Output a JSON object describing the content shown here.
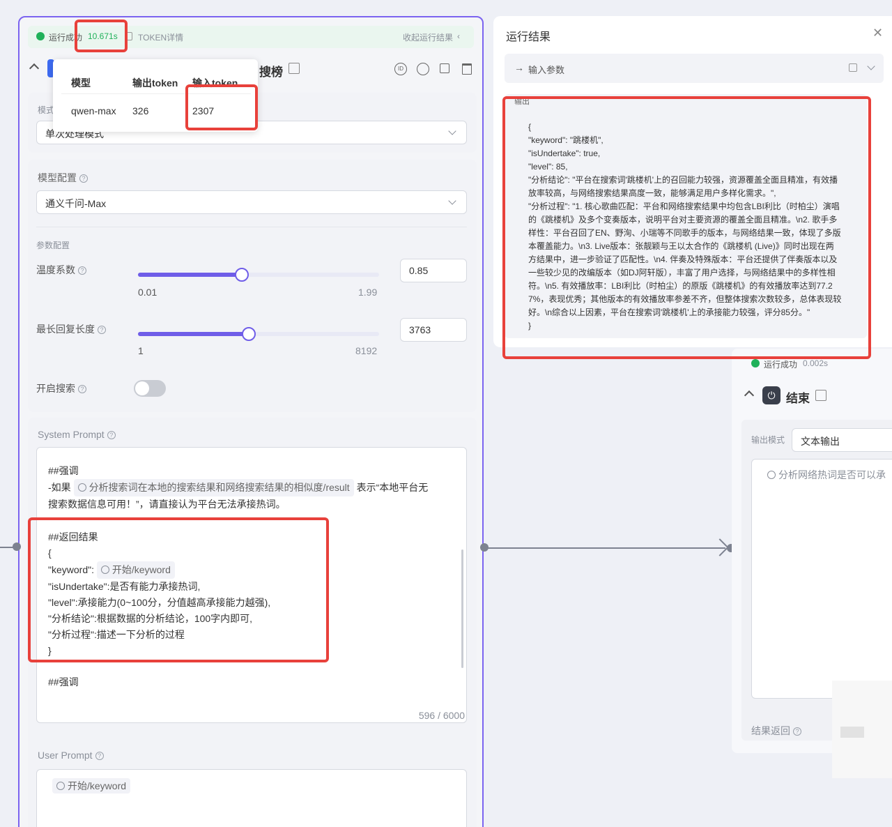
{
  "left": {
    "status": {
      "text": "运行成功",
      "time": "10.671s",
      "token_link": "TOKEN详情",
      "collapse": "收起运行结果"
    },
    "node_title": "搜榜",
    "token_table": {
      "headers": [
        "模型",
        "输出token",
        "输入token"
      ],
      "row": [
        "qwen-max",
        "326",
        "2307"
      ]
    },
    "mode": {
      "label": "模式",
      "value": "单次处理模式"
    },
    "model_config": {
      "label": "模型配置",
      "value": "通义千问-Max"
    },
    "params": {
      "label": "参数配置",
      "temperature": {
        "label": "温度系数",
        "min": "0.01",
        "max": "1.99",
        "value": "0.85",
        "fraction": 0.43
      },
      "max_length": {
        "label": "最长回复长度",
        "min": "1",
        "max": "8192",
        "value": "3763",
        "fraction": 0.46
      },
      "search": {
        "label": "开启搜索",
        "enabled": false
      }
    },
    "system_prompt": {
      "label": "System Prompt",
      "l1": "##强调",
      "l2a": "-如果",
      "l2_tag": "分析搜索词在本地的搜索结果和网络搜索结果的相似度/result",
      "l2b": "表示“本地平台无",
      "l3": "搜索数据信息可用！”，请直接认为平台无法承接热词。",
      "l4": "##返回结果",
      "l5": "{",
      "l6a": "\"keyword\":",
      "l6_tag": "开始/keyword",
      "l7": "\"isUndertake\":是否有能力承接热词,",
      "l8": "\"level\":承接能力(0~100分，分值越高承接能力越强),",
      "l9": "\"分析结论\":根据数据的分析结论，100字内即可,",
      "l10": "\"分析过程\":描述一下分析的过程",
      "l11": "}",
      "l12": "##强调",
      "counter": "596 / 6000"
    },
    "user_prompt": {
      "label": "User Prompt",
      "tag": "开始/keyword"
    }
  },
  "right": {
    "title": "运行结果",
    "input_params": "输入参数",
    "output_label": "输出",
    "json_lines": [
      "{",
      "\"keyword\": \"跳楼机\",",
      "\"isUndertake\": true,",
      "\"level\": 85,",
      "\"分析结论\": \"平台在搜索词'跳楼机'上的召回能力较强，资源覆盖全面且精准，有效播",
      "放率较高，与网络搜索结果高度一致，能够满足用户多样化需求。\",",
      "\"分析过程\": \"1. 核心歌曲匹配：平台和网络搜索结果中均包含LBI利比（时柏尘）演唱",
      "的《跳楼机》及多个变奏版本，说明平台对主要资源的覆盖全面且精准。\\n2. 歌手多",
      "样性：平台召回了EN、野洵、小瑞等不同歌手的版本，与网络结果一致，体现了多版",
      "本覆盖能力。\\n3. Live版本：张靓颖与王以太合作的《跳楼机 (Live)》同时出现在两",
      "方结果中，进一步验证了匹配性。\\n4. 伴奏及特殊版本：平台还提供了伴奏版本以及",
      "一些较少见的改编版本（如DJ阿轩版），丰富了用户选择，与网络结果中的多样性相",
      "符。\\n5. 有效播放率：LBI利比（时柏尘）的原版《跳楼机》的有效播放率达到77.2",
      "7%，表现优秀；其他版本的有效播放率参差不齐，但整体搜索次数较多，总体表现较",
      "好。\\n综合以上因素，平台在搜索词'跳楼机'上的承接能力较强，评分85分。\"",
      "}"
    ]
  },
  "end_node": {
    "status": "运行成功",
    "time": "0.002s",
    "title": "结束",
    "output_mode_label": "输出模式",
    "output_mode_value": "文本输出",
    "var_tag": "分析网络热词是否可以承",
    "return_label": "结果返回"
  },
  "colors": {
    "accent": "#6f5de8",
    "highlight": "#e8413b",
    "success": "#20b15a"
  }
}
